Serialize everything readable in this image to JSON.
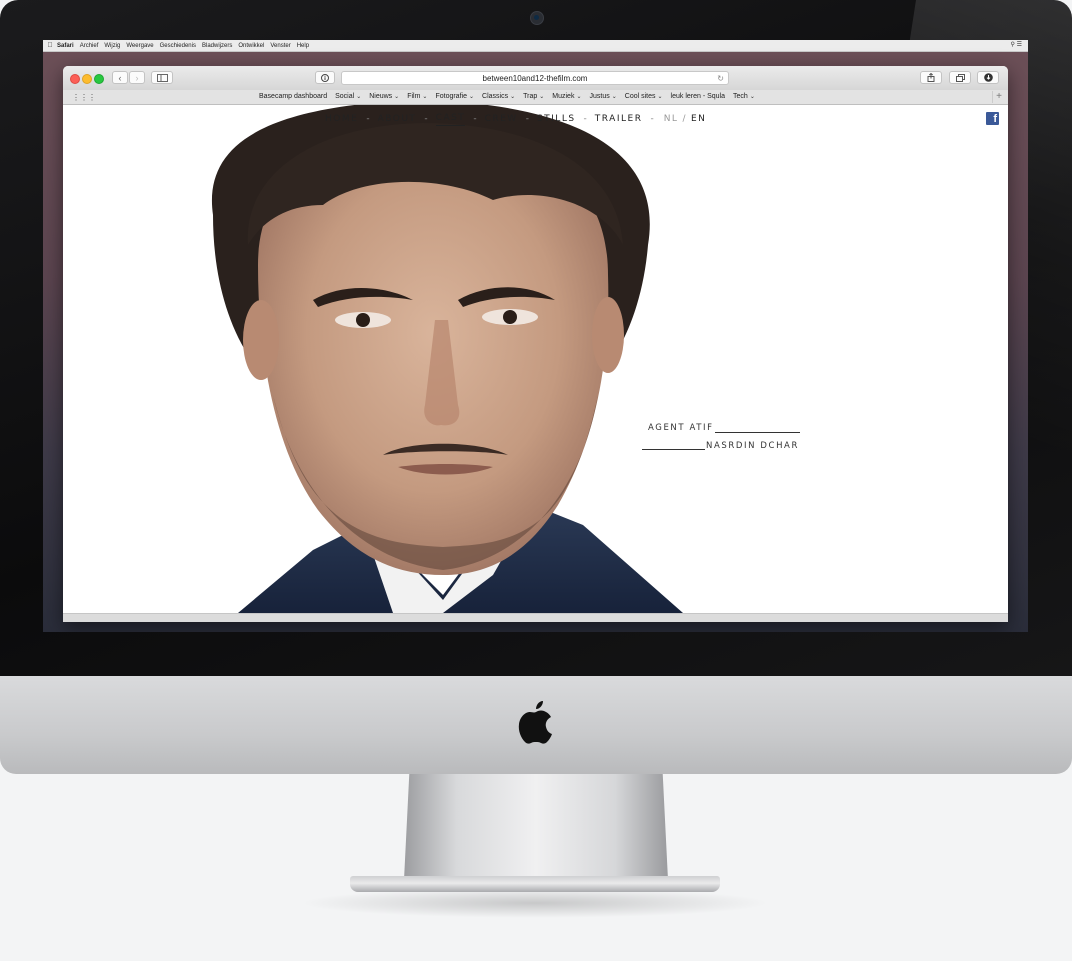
{
  "menubar": {
    "items": [
      "Safari",
      "Archief",
      "Wijzig",
      "Weergave",
      "Geschiedenis",
      "Bladwijzers",
      "Ontwikkel",
      "Venster",
      "Help"
    ]
  },
  "browser": {
    "url": "between10and12-thefilm.com",
    "bookmarks": [
      {
        "label": "Basecamp dashboard",
        "dropdown": false
      },
      {
        "label": "Social",
        "dropdown": true
      },
      {
        "label": "Nieuws",
        "dropdown": true
      },
      {
        "label": "Film",
        "dropdown": true
      },
      {
        "label": "Fotografie",
        "dropdown": true
      },
      {
        "label": "Classics",
        "dropdown": true
      },
      {
        "label": "Trap",
        "dropdown": true
      },
      {
        "label": "Muziek",
        "dropdown": true
      },
      {
        "label": "Justus",
        "dropdown": true
      },
      {
        "label": "Cool sites",
        "dropdown": true
      },
      {
        "label": "leuk leren - Squla",
        "dropdown": false
      },
      {
        "label": "Tech",
        "dropdown": true
      }
    ]
  },
  "site": {
    "nav": {
      "home": "HOME",
      "about": "ABOUT",
      "cast": "CAST",
      "crew": "CREW",
      "stills": "STILLS",
      "trailer": "TRAILER",
      "separator": "-",
      "lang_nl": "NL",
      "lang_sep": "/",
      "lang_en": "EN"
    },
    "active_tab": "CAST",
    "credit": {
      "role": "AGENT ATIF",
      "actor": "NASRDIN DCHAR"
    }
  },
  "colors": {
    "facebook": "#3b5998",
    "traffic_red": "#fc5f57",
    "traffic_yellow": "#fdbc2e",
    "traffic_green": "#28c840"
  },
  "icons": {
    "facebook": "facebook-icon",
    "apple": "apple-logo-icon"
  }
}
